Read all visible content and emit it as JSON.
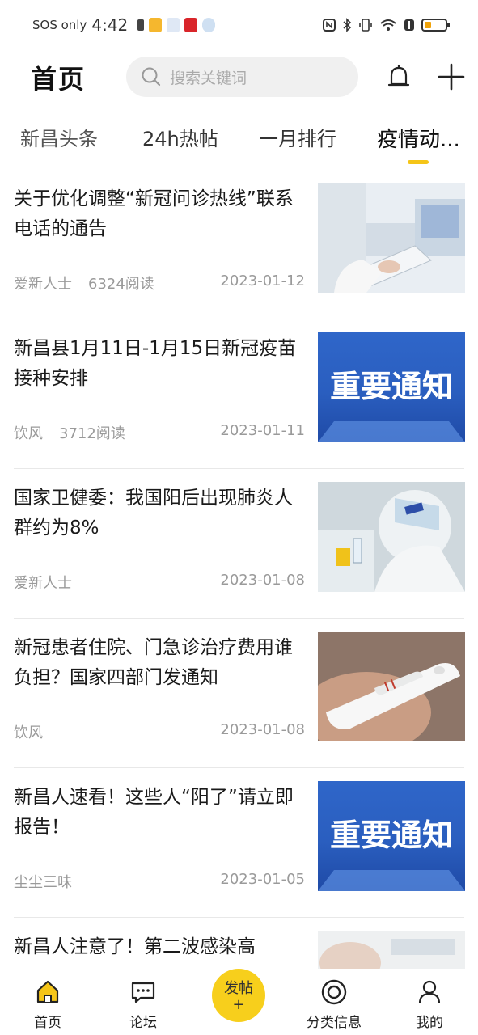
{
  "status_bar": {
    "carrier": "SOS only",
    "time": "4:42"
  },
  "header": {
    "title": "首页",
    "search_placeholder": "搜索关键词"
  },
  "tabs": [
    {
      "label": "新昌头条"
    },
    {
      "label": "24h热帖"
    },
    {
      "label": "一月排行"
    },
    {
      "label": "疫情动..."
    }
  ],
  "articles": [
    {
      "title": "关于优化调整“新冠问诊热线”联系电话的通告",
      "author": "爱新人士",
      "reads": "6324阅读",
      "date": "2023-01-12",
      "thumb": "medical-tablet"
    },
    {
      "title": "新昌县1月11日-1月15日新冠疫苗接种安排",
      "author": "饮风",
      "reads": "3712阅读",
      "date": "2023-01-11",
      "thumb": "notice",
      "thumb_text": "重要通知"
    },
    {
      "title": "国家卫健委：我国阳后出现肺炎人群约为8%",
      "author": "爱新人士",
      "reads": "",
      "date": "2023-01-08",
      "thumb": "lab-worker"
    },
    {
      "title": "新冠患者住院、门急诊治疗费用谁负担？国家四部门发通知",
      "author": "饮风",
      "reads": "",
      "date": "2023-01-08",
      "thumb": "test-kit"
    },
    {
      "title": "新昌人速看！这些人“阳了”请立即报告！",
      "author": "尘尘三味",
      "reads": "",
      "date": "2023-01-05",
      "thumb": "notice",
      "thumb_text": "重要通知"
    },
    {
      "title": "新昌人注意了！第二波感染高",
      "author": "",
      "reads": "",
      "date": "",
      "thumb": "hand"
    }
  ],
  "bottom_nav": {
    "home": "首页",
    "forum": "论坛",
    "post": "发帖",
    "post_plus": "+",
    "category": "分类信息",
    "mine": "我的"
  },
  "colors": {
    "accent": "#f5c518",
    "post_button": "#f7cf1c",
    "notice_blue": "#2f66c9"
  }
}
